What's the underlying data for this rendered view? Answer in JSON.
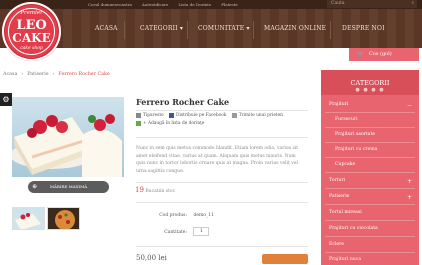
{
  "topnav": [
    "Cosul dumneavoastra",
    "Autentificare",
    "Lista de Dorinte",
    "Plateste"
  ],
  "search": {
    "placeholder": "Cauta"
  },
  "logo": {
    "top": "Premier",
    "line1": "LEO",
    "line2": "CAKE",
    "bottom": "cake shop"
  },
  "mainnav": [
    "ACASA",
    "CATEGORII ▾",
    "COMUNITATE ▾",
    "MAGAZIN ONLINE",
    "DESPRE NOI"
  ],
  "cart": {
    "label": "Cos (gol)"
  },
  "breadcrumb": {
    "home": "Acasa",
    "parent": "Patiserie",
    "current": "Ferrero Rocher Cake"
  },
  "product": {
    "title": "Ferrero Rocher Cake",
    "links": [
      "Tipareste",
      "Distribuie pe Facebook",
      "Trimite unui prieten",
      "+ Adaugă în lista de dorinţe"
    ],
    "description": "Nunc in sem quis metus commodo blandit. Etiam lorem odio, varius sit amet eleifend vitae, varius at quam. Aliquam quis metus mauris. Nam quis nunc in tortor lobortis ornare quis at magna. Proin varius velit vel urna sagittis congue.",
    "stock_count": "19",
    "stock_label": "Bucatiin stoc",
    "code_label": "Cod produs:",
    "code_value": "demo_11",
    "qty_label": "Cantitate:",
    "qty_value": "1",
    "price": "50,00 lei",
    "magnify_label": "MĂRIRE MAXIMĂ"
  },
  "sidebar": {
    "title": "CATEGORII",
    "dots": "● ● ● ●",
    "items": [
      {
        "label": "Prajituri",
        "sign": "−"
      },
      {
        "label": "Fursecuri",
        "sign": ""
      },
      {
        "label": "Prajituri asortate",
        "sign": ""
      },
      {
        "label": "Prajituri cu crema",
        "sign": ""
      },
      {
        "label": "Cupcake",
        "sign": ""
      },
      {
        "label": "Torturi",
        "sign": "+"
      },
      {
        "label": "Patiserie",
        "sign": "+"
      },
      {
        "label": "Tortul mireasi",
        "sign": ""
      },
      {
        "label": "Prajituri cu ciocolata",
        "sign": ""
      },
      {
        "label": "Eclere",
        "sign": ""
      },
      {
        "label": "Prajituri nuca",
        "sign": ""
      }
    ]
  },
  "colors": {
    "accent": "#e8646e",
    "header": "#5a3626",
    "price_red": "#d84a4a"
  }
}
